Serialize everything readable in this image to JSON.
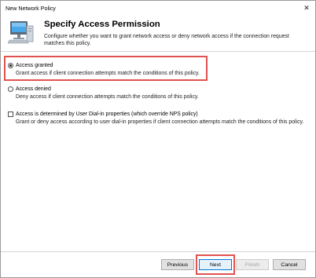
{
  "window": {
    "title": "New Network Policy",
    "close_glyph": "✕"
  },
  "header": {
    "title": "Specify Access Permission",
    "subtitle": "Configure whether you want to grant network access or deny network access if the connection request matches this policy.",
    "icon": "network-computer-icon"
  },
  "options": [
    {
      "label": "Access granted",
      "description": "Grant access if client connection attempts match the conditions of this policy.",
      "type": "radio",
      "selected": true
    },
    {
      "label": "Access denied",
      "description": "Deny access if client connection attempts match the conditions of this policy.",
      "type": "radio",
      "selected": false
    },
    {
      "label": "Access is determined by User Dial-in properties (which override NPS policy)",
      "description": "Grant or deny access according to user dial-in properties if client connection attempts match the conditions of this policy.",
      "type": "checkbox",
      "checked": false
    }
  ],
  "buttons": {
    "previous": "Previous",
    "next": "Next",
    "finish": "Finish",
    "cancel": "Cancel"
  },
  "colors": {
    "highlight": "#e0524f",
    "accent": "#0078d7"
  }
}
